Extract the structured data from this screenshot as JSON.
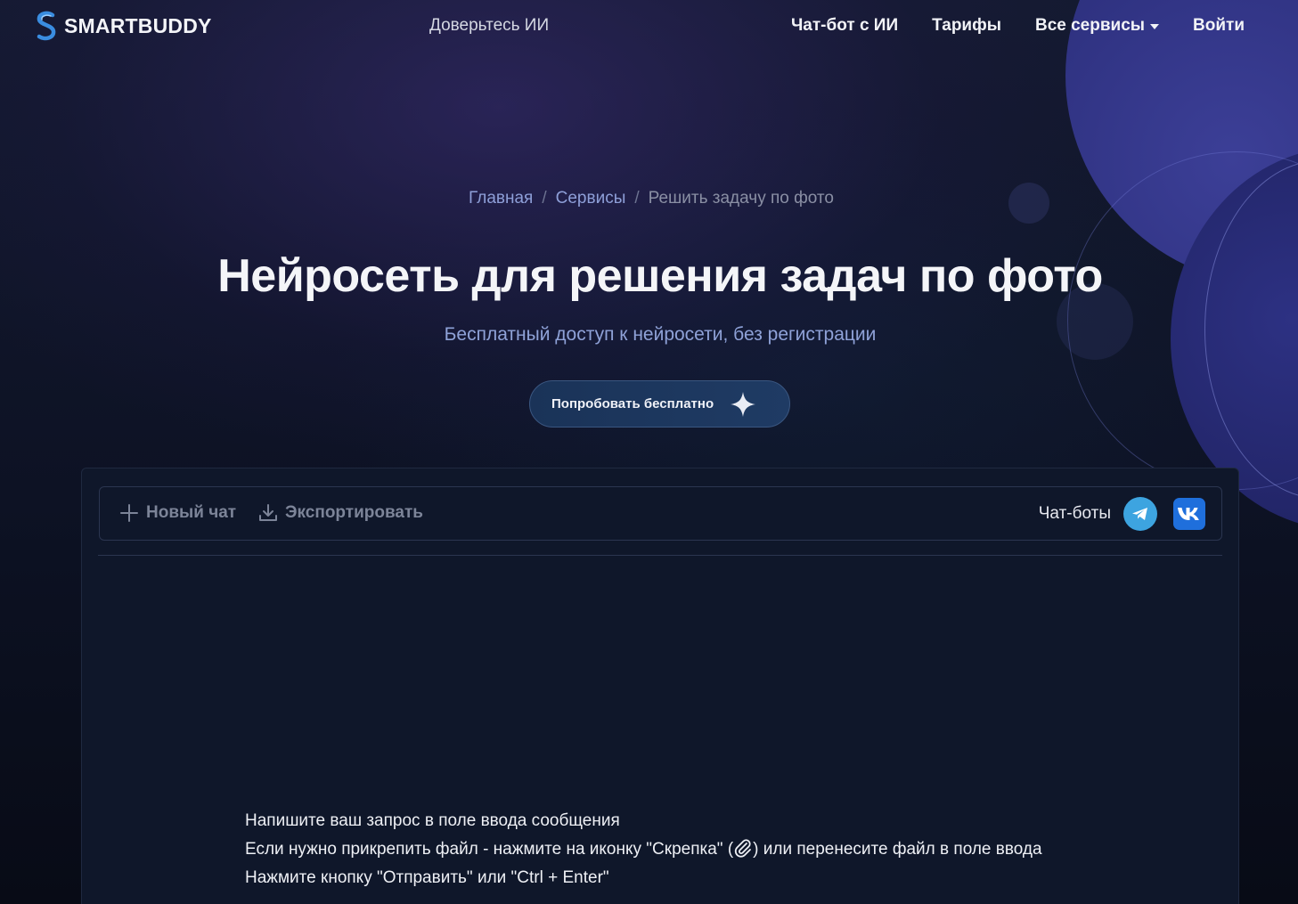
{
  "header": {
    "brand": "SMARTBUDDY",
    "tagline": "Доверьтесь ИИ",
    "nav": {
      "chatbot": "Чат-бот с ИИ",
      "tariffs": "Тарифы",
      "all_services": "Все сервисы",
      "login": "Войти"
    }
  },
  "breadcrumb": {
    "home": "Главная",
    "services": "Сервисы",
    "current": "Решить задачу по фото",
    "separator": "/"
  },
  "hero": {
    "title": "Нейросеть для решения задач по фото",
    "subtitle": "Бесплатный доступ к нейросети, без регистрации",
    "cta_label": "Попробовать бесплатно",
    "cta_icon": "sparkle-icon"
  },
  "chat": {
    "new_chat_label": "Новый чат",
    "export_label": "Экспортировать",
    "bots_label": "Чат-боты",
    "hint_line1": "Напишите ваш запрос в поле ввода сообщения",
    "hint_line2_before": "Если нужно прикрепить файл - нажмите на иконку \"Скрепка\" (",
    "hint_line2_after": ") или перенесите файл в поле ввода",
    "hint_line3": "Нажмите кнопку \"Отправить\" или \"Ctrl + Enter\""
  },
  "colors": {
    "accent": "#8fa2d8",
    "telegram": "#3da4e0",
    "vk": "#1f6fdc",
    "cta_bg": "#1a3358"
  }
}
